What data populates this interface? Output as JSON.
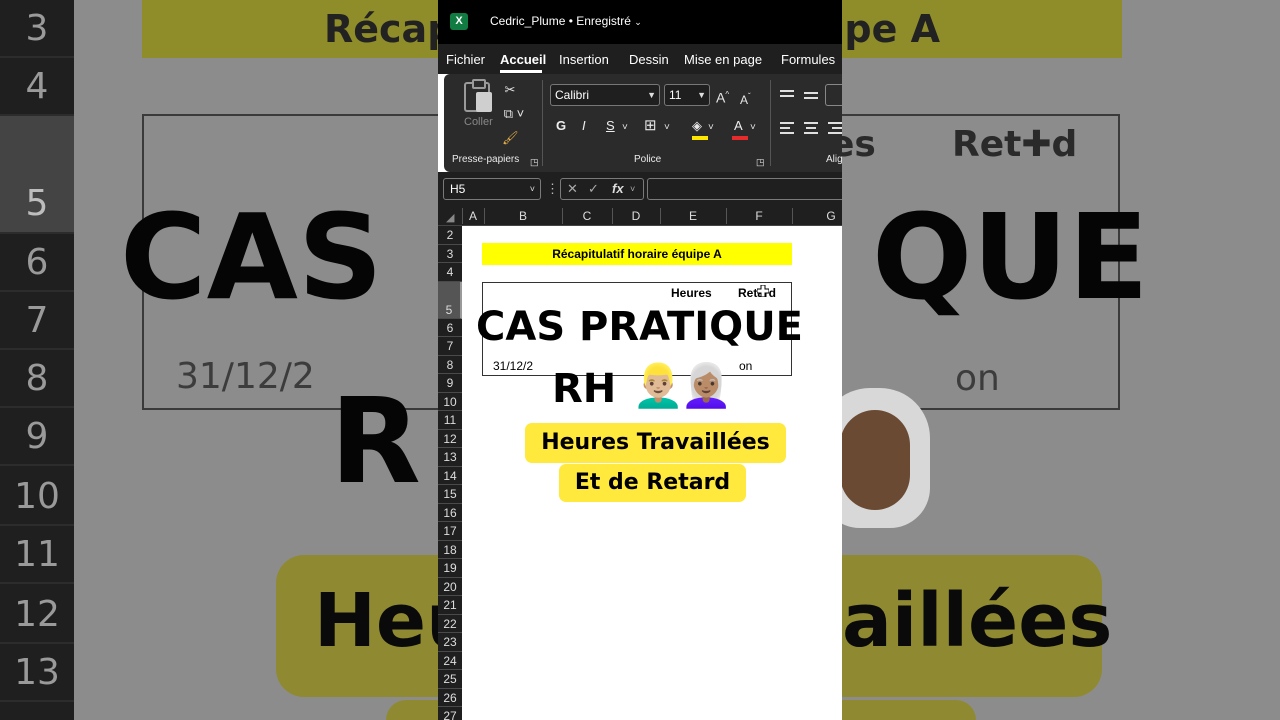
{
  "background": {
    "row_numbers": [
      "3",
      "4",
      "5",
      "6",
      "7",
      "8",
      "9",
      "10",
      "11",
      "12",
      "13"
    ],
    "title_left": "Récap",
    "title_right": "ipe A",
    "big_line1": "CAS",
    "big_line1_right": "QUE",
    "big_line2": "R",
    "heures_partial": "es",
    "retard": "Ret✚d",
    "date_partial": "31/12/2",
    "on_partial": "on",
    "pill_left": "Heu",
    "pill_right": "aillées"
  },
  "window": {
    "doc_title": "Cedric_Plume • Enregistré",
    "menu": [
      "Fichier",
      "Accueil",
      "Insertion",
      "Dessin",
      "Mise en page",
      "Formules"
    ],
    "active_menu": "Accueil",
    "ribbon": {
      "paste_label": "Coller",
      "clipboard_group": "Presse-papiers",
      "font_name": "Calibri",
      "font_size": "11",
      "bold": "G",
      "italic": "I",
      "underline": "S",
      "font_group": "Police",
      "align_group_partial": "Alig",
      "grow_font": "A^",
      "shrink_font": "Aˇ",
      "font_color_letter": "A"
    },
    "name_box": "H5",
    "fx_label": "fx",
    "columns": [
      "A",
      "B",
      "C",
      "D",
      "E",
      "F",
      "G"
    ],
    "rows": [
      "2",
      "3",
      "4",
      "5",
      "6",
      "7",
      "8",
      "9",
      "10",
      "11",
      "12",
      "13",
      "14",
      "15",
      "16",
      "17",
      "18",
      "19",
      "20",
      "21",
      "22",
      "23",
      "24",
      "25",
      "26",
      "27"
    ],
    "selected_row": "5",
    "sheet": {
      "title": "Récapitulatif horaire équipe A",
      "heures": "Heures",
      "retard": "Retard",
      "date": "31/12/2",
      "on_partial": "on"
    }
  },
  "overlay": {
    "headline1": "CAS PRATIQUE",
    "headline2": "RH",
    "emoji_man": "👱🏼‍♂️",
    "emoji_woman": "👩🏽‍🦳",
    "pill1": "Heures Travaillées",
    "pill2": "Et de Retard"
  },
  "colors": {
    "excel_green": "#107c41",
    "highlight_yellow": "#ffff00",
    "pill_yellow": "#ffe93d",
    "dark_ui": "#1f1f1f"
  }
}
